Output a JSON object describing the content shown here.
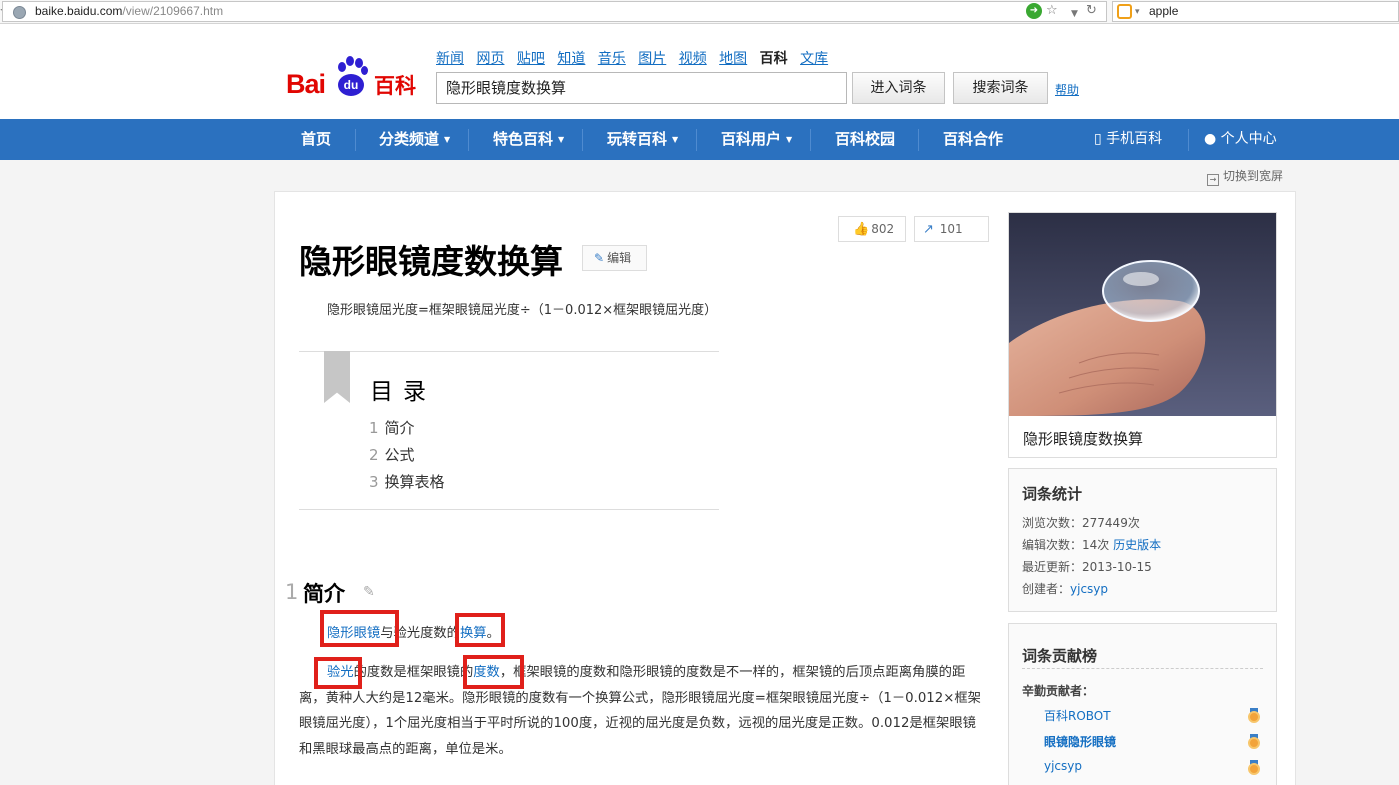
{
  "browser": {
    "url_host": "baike.baidu.com",
    "url_path": "/view/2109667.htm",
    "search_text": "apple"
  },
  "header": {
    "logo_latin": "Bai",
    "logo_du": "du",
    "logo_cn": "百科",
    "top_nav": [
      "新闻",
      "网页",
      "贴吧",
      "知道",
      "音乐",
      "图片",
      "视频",
      "地图",
      "百科",
      "文库"
    ],
    "search_value": "隐形眼镜度数换算",
    "enter_button": "进入词条",
    "search_button": "搜索词条",
    "help": "帮助"
  },
  "main_nav": {
    "items": [
      "首页",
      "分类频道",
      "特色百科",
      "玩转百科",
      "百科用户",
      "百科校园",
      "百科合作"
    ],
    "mobile": "手机百科",
    "personal": "个人中心"
  },
  "toolbar": {
    "switch_wide": "切换到宽屏",
    "likes": "802",
    "shares": "101",
    "edit": "编辑"
  },
  "article": {
    "title": "隐形眼镜度数换算",
    "summary": "隐形眼镜屈光度=框架眼镜屈光度÷（1－0.012×框架眼镜屈光度）",
    "toc_title": "目录",
    "toc": [
      {
        "num": "1",
        "label": "简介"
      },
      {
        "num": "2",
        "label": "公式"
      },
      {
        "num": "3",
        "label": "换算表格"
      }
    ],
    "section1_num": "1",
    "section1_title": "简介",
    "p1": {
      "link1": "隐形眼镜",
      "text1": "与验光度数的",
      "link2": "换算",
      "text2": "。"
    },
    "p2": {
      "link1": "验光",
      "text1": "的度数是框架眼镜的",
      "link2": "度数",
      "text2": "，框架眼镜的度数和隐形眼镜的度数是不一样的，框架镜的后顶点距离角膜的距离，黄种人大约是12毫米。隐形眼镜的度数有一个换算公式，隐形眼镜屈光度=框架眼镜屈光度÷（1－0.012×框架眼镜屈光度），1个屈光度相当于平时所说的100度，近视的屈光度是负数，远视的屈光度是正数。0.012是框架眼镜和黑眼球最高点的距离，单位是米。"
    }
  },
  "sidebar": {
    "image_caption": "隐形眼镜度数换算",
    "stats_title": "词条统计",
    "views_label": "浏览次数：",
    "views": "277449次",
    "edits_label": "编辑次数：",
    "edits": "14次",
    "history_link": "历史版本",
    "updated_label": "最近更新：",
    "updated": "2013-10-15",
    "creator_label": "创建者：",
    "creator": "yjcsyp",
    "contrib_title": "词条贡献榜",
    "contrib_sub": "辛勤贡献者：",
    "contributors": [
      "百科ROBOT",
      "眼镜隐形眼镜",
      "yjcsyp"
    ]
  },
  "colors": {
    "nav_blue": "#2b71bf",
    "link_blue": "#136ec2",
    "highlight_red": "#e0201a",
    "logo_red": "#e10602"
  }
}
